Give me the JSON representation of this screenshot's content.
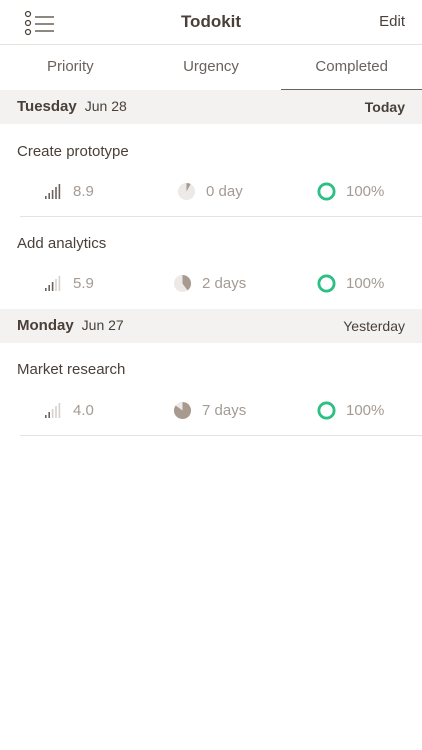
{
  "nav": {
    "title": "Todokit",
    "edit_label": "Edit"
  },
  "tabs": [
    {
      "label": "Priority",
      "active": false
    },
    {
      "label": "Urgency",
      "active": false
    },
    {
      "label": "Completed",
      "active": true
    }
  ],
  "sections": [
    {
      "day": "Tuesday",
      "date": "Jun 28",
      "relative": "Today",
      "tasks": [
        {
          "title": "Create prototype",
          "priority": "8.9",
          "priority_bars_filled": 5,
          "duration": "0 day",
          "duration_fraction": 0.08,
          "progress": "100%"
        },
        {
          "title": "Add analytics",
          "priority": "5.9",
          "priority_bars_filled": 3,
          "duration": "2 days",
          "duration_fraction": 0.4,
          "progress": "100%"
        }
      ]
    },
    {
      "day": "Monday",
      "date": "Jun 27",
      "relative": "Yesterday",
      "tasks": [
        {
          "title": "Market research",
          "priority": "4.0",
          "priority_bars_filled": 2,
          "duration": "7 days",
          "duration_fraction": 0.85,
          "progress": "100%"
        }
      ]
    }
  ],
  "colors": {
    "accent_green": "#2dbf83",
    "text": "#4a4039",
    "muted": "#a39b94",
    "pie": "#a89a8e"
  }
}
